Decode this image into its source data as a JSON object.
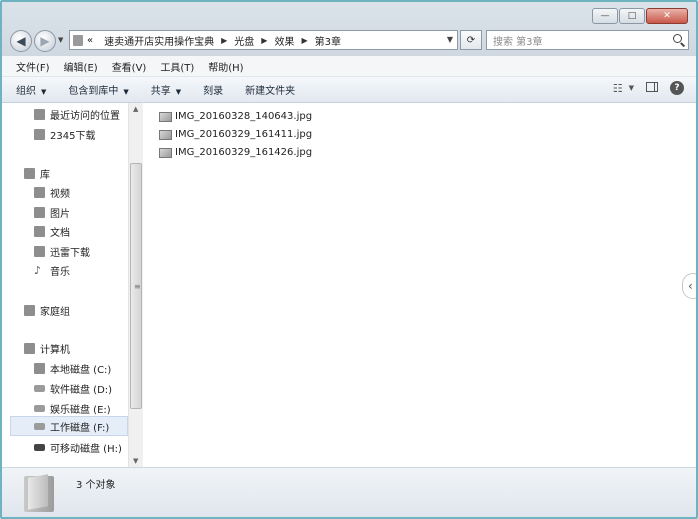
{
  "titlebar": {
    "minimize_label": "—",
    "maximize_label": "□",
    "close_label": "✕"
  },
  "address": {
    "overflow": "«",
    "crumbs": [
      "速卖通开店实用操作宝典",
      "光盘",
      "效果",
      "第3章"
    ]
  },
  "search": {
    "placeholder": "搜索 第3章"
  },
  "menu": [
    "文件(F)",
    "编辑(E)",
    "查看(V)",
    "工具(T)",
    "帮助(H)"
  ],
  "toolbar": {
    "organize": "组织",
    "include_library": "包含到库中",
    "share": "共享",
    "burn": "刻录",
    "new_folder": "新建文件夹"
  },
  "nav": {
    "recent": "最近访问的位置",
    "download2345": "2345下载",
    "libraries": "库",
    "videos": "视频",
    "pictures": "图片",
    "documents": "文档",
    "thunder": "迅雷下载",
    "music": "音乐",
    "homegroup": "家庭组",
    "computer": "计算机",
    "drive_c": "本地磁盘 (C:)",
    "drive_d": "软件磁盘 (D:)",
    "drive_e": "娱乐磁盘 (E:)",
    "drive_f": "工作磁盘 (F:)",
    "drive_h": "可移动磁盘 (H:)"
  },
  "files": [
    "IMG_20160328_140643.jpg",
    "IMG_20160329_161411.jpg",
    "IMG_20160329_161426.jpg"
  ],
  "status": {
    "count": "3 个对象"
  }
}
